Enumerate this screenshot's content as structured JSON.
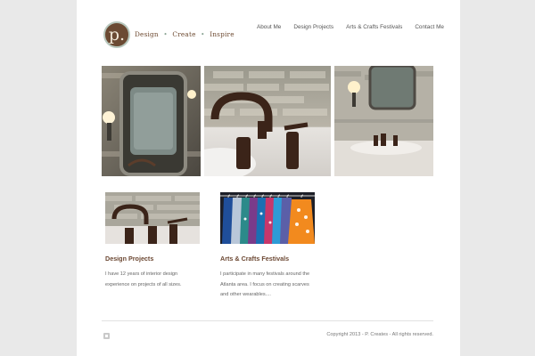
{
  "header": {
    "logo_letter": "p.",
    "tagline": [
      "Design",
      "Create",
      "Inspire"
    ],
    "tagline_separator": "•"
  },
  "nav": {
    "items": [
      {
        "label": "About Me"
      },
      {
        "label": "Design Projects"
      },
      {
        "label": "Arts & Crafts Festivals"
      },
      {
        "label": "Contact Me"
      }
    ]
  },
  "gallery": {
    "images": [
      {
        "subject": "ornate-mirror-photo"
      },
      {
        "subject": "bronze-faucet-photo"
      },
      {
        "subject": "vanity-sink-photo"
      }
    ]
  },
  "cards": [
    {
      "title": "Design Projects",
      "text": "I have 12 years of interior design experience on projects of all sizes."
    },
    {
      "title": "Arts & Crafts Festivals",
      "text": "I participate in many festivals around the Atlanta area. I focus on creating scarves and other wearables...."
    }
  ],
  "footer": {
    "copyright": "Copyright 2013 - P. Creates - All rights reserved."
  },
  "colors": {
    "brand_brown": "#6c4833",
    "accent_green": "#8aa493",
    "page_background": "#e9e9e9"
  }
}
